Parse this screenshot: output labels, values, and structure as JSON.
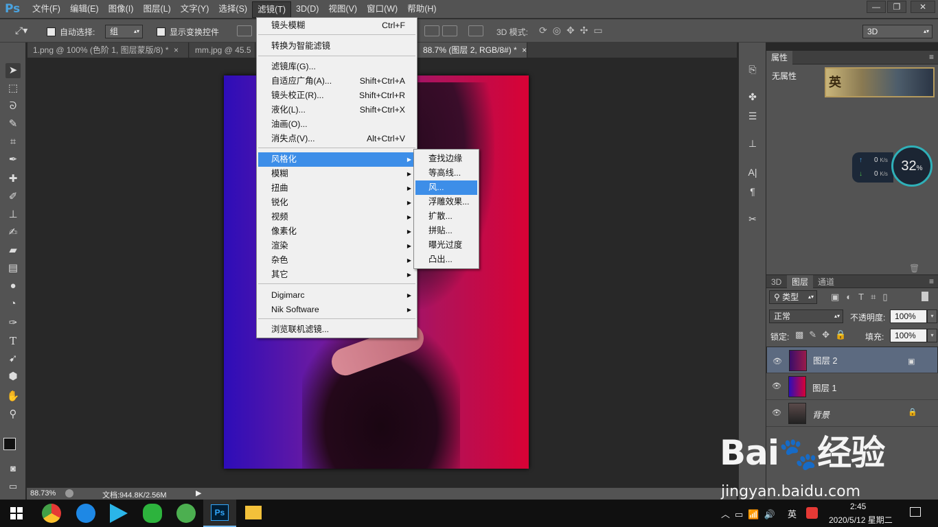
{
  "app": {
    "logo": "Ps"
  },
  "menubar": [
    "文件(F)",
    "编辑(E)",
    "图像(I)",
    "图层(L)",
    "文字(Y)",
    "选择(S)",
    "滤镜(T)",
    "3D(D)",
    "视图(V)",
    "窗口(W)",
    "帮助(H)"
  ],
  "options": {
    "auto_select": "自动选择:",
    "group_value": "组",
    "show_transform": "显示变换控件",
    "mode3d": "3D 模式:",
    "workspace": "3D"
  },
  "tabs": [
    "1.png @ 100% (色阶 1, 图层蒙版/8) *",
    "mm.jpg @ 45.5",
    "88.7% (图层 2, RGB/8#) *"
  ],
  "filter_menu": {
    "items": [
      {
        "label": "镜头模糊",
        "shortcut": "Ctrl+F"
      },
      {
        "label": "转换为智能滤镜",
        "shortcut": ""
      },
      {
        "label": "滤镜库(G)...",
        "shortcut": ""
      },
      {
        "label": "自适应广角(A)...",
        "shortcut": "Shift+Ctrl+A"
      },
      {
        "label": "镜头校正(R)...",
        "shortcut": "Shift+Ctrl+R"
      },
      {
        "label": "液化(L)...",
        "shortcut": "Shift+Ctrl+X"
      },
      {
        "label": "油画(O)...",
        "shortcut": ""
      },
      {
        "label": "消失点(V)...",
        "shortcut": "Alt+Ctrl+V"
      },
      {
        "label": "风格化",
        "shortcut": ""
      },
      {
        "label": "模糊",
        "shortcut": ""
      },
      {
        "label": "扭曲",
        "shortcut": ""
      },
      {
        "label": "锐化",
        "shortcut": ""
      },
      {
        "label": "视频",
        "shortcut": ""
      },
      {
        "label": "像素化",
        "shortcut": ""
      },
      {
        "label": "渲染",
        "shortcut": ""
      },
      {
        "label": "杂色",
        "shortcut": ""
      },
      {
        "label": "其它",
        "shortcut": ""
      },
      {
        "label": "Digimarc",
        "shortcut": ""
      },
      {
        "label": "Nik Software",
        "shortcut": ""
      },
      {
        "label": "浏览联机滤镜...",
        "shortcut": ""
      }
    ]
  },
  "stylize_submenu": [
    "查找边缘",
    "等高线...",
    "风...",
    "浮雕效果...",
    "扩散...",
    "拼贴...",
    "曝光过度",
    "凸出..."
  ],
  "properties": {
    "tab": "属性",
    "text": "无属性",
    "badge": "英"
  },
  "netwidget": {
    "up": "0",
    "down": "0",
    "unit": "K/s",
    "gauge": "32",
    "gauge_unit": "%"
  },
  "layers_panel": {
    "tabs": [
      "3D",
      "图层",
      "通道"
    ],
    "kind": "类型",
    "blend": "正常",
    "opacity_label": "不透明度:",
    "opacity": "100%",
    "lock_label": "锁定:",
    "fill_label": "填充:",
    "fill": "100%",
    "layers": [
      {
        "name": "图层 2"
      },
      {
        "name": "图层 1"
      },
      {
        "name": "背景"
      }
    ]
  },
  "status": {
    "zoom": "88.73%",
    "doc": "文档:944.8K/2.56M"
  },
  "watermark": {
    "brand": "Bai",
    "brand2": "经验",
    "url": "jingyan.baidu.com"
  },
  "taskbar": {
    "ime": "英",
    "time": "2:45",
    "date": "2020/5/12 星期二"
  },
  "colors": {
    "accent": "#3d8ee8",
    "canvas_left": "#2d0db8",
    "canvas_right": "#d80235",
    "panel": "#535353"
  }
}
